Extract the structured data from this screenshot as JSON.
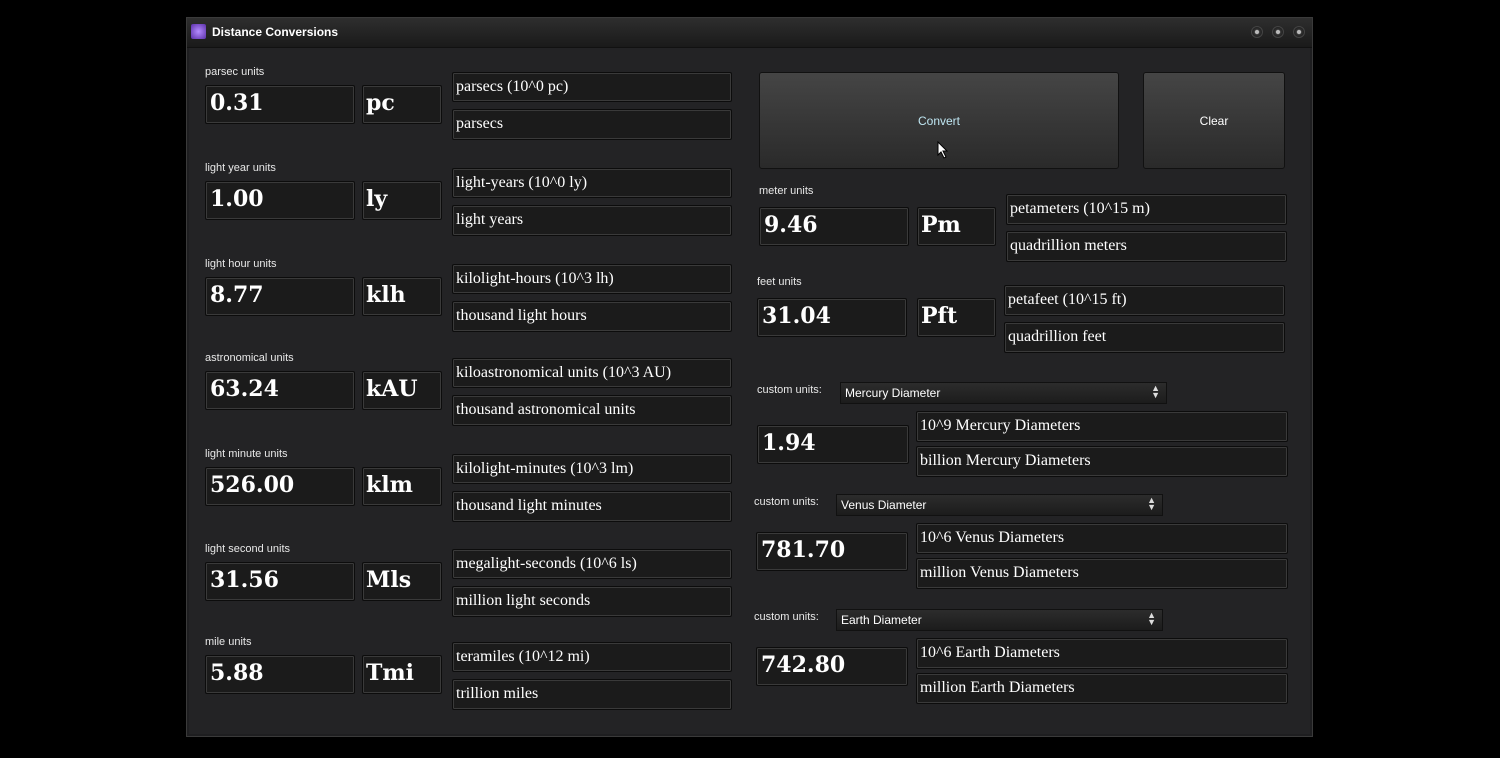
{
  "window": {
    "title": "Distance Conversions",
    "controls": [
      "minimize",
      "maximize",
      "close"
    ]
  },
  "left_rows": [
    {
      "label": "parsec units",
      "value": "0.31",
      "unit": "pc",
      "scaled_name": "parsecs  (10^0 pc)",
      "word_name": "parsecs"
    },
    {
      "label": "light year units",
      "value": "1.00",
      "unit": "ly",
      "scaled_name": "light-years  (10^0 ly)",
      "word_name": "light years"
    },
    {
      "label": "light hour units",
      "value": "8.77",
      "unit": "klh",
      "scaled_name": "kilolight-hours  (10^3 lh)",
      "word_name": "thousand light hours"
    },
    {
      "label": "astronomical units",
      "value": "63.24",
      "unit": "kAU",
      "scaled_name": "kiloastronomical units  (10^3 AU)",
      "word_name": "thousand astronomical units"
    },
    {
      "label": "light minute units",
      "value": "526.00",
      "unit": "klm",
      "scaled_name": "kilolight-minutes  (10^3 lm)",
      "word_name": "thousand light minutes"
    },
    {
      "label": "light second units",
      "value": "31.56",
      "unit": "Mls",
      "scaled_name": "megalight-seconds  (10^6 ls)",
      "word_name": "million light seconds"
    },
    {
      "label": "mile units",
      "value": "5.88",
      "unit": "Tmi",
      "scaled_name": "teramiles  (10^12 mi)",
      "word_name": "trillion miles"
    }
  ],
  "buttons": {
    "convert": "Convert",
    "clear": "Clear"
  },
  "right_rows": [
    {
      "label": "meter units",
      "value": "9.46",
      "unit": "Pm",
      "scaled_name": "petameters  (10^15 m)",
      "word_name": "quadrillion meters"
    },
    {
      "label": "feet units",
      "value": "31.04",
      "unit": "Pft",
      "scaled_name": "petafeet  (10^15 ft)",
      "word_name": "quadrillion feet"
    }
  ],
  "custom_rows": [
    {
      "label": "custom units:",
      "selected": "Mercury Diameter",
      "value": "1.94",
      "scaled_name": "10^9 Mercury Diameters",
      "word_name": "billion Mercury Diameters"
    },
    {
      "label": "custom units:",
      "selected": "Venus Diameter",
      "value": "781.70",
      "scaled_name": "10^6 Venus Diameters",
      "word_name": "million Venus Diameters"
    },
    {
      "label": "custom units:",
      "selected": "Earth Diameter",
      "value": "742.80",
      "scaled_name": "10^6 Earth Diameters",
      "word_name": "million Earth Diameters"
    }
  ],
  "colors": {
    "convert_text": "#bfe6f2",
    "background": "#232325"
  }
}
